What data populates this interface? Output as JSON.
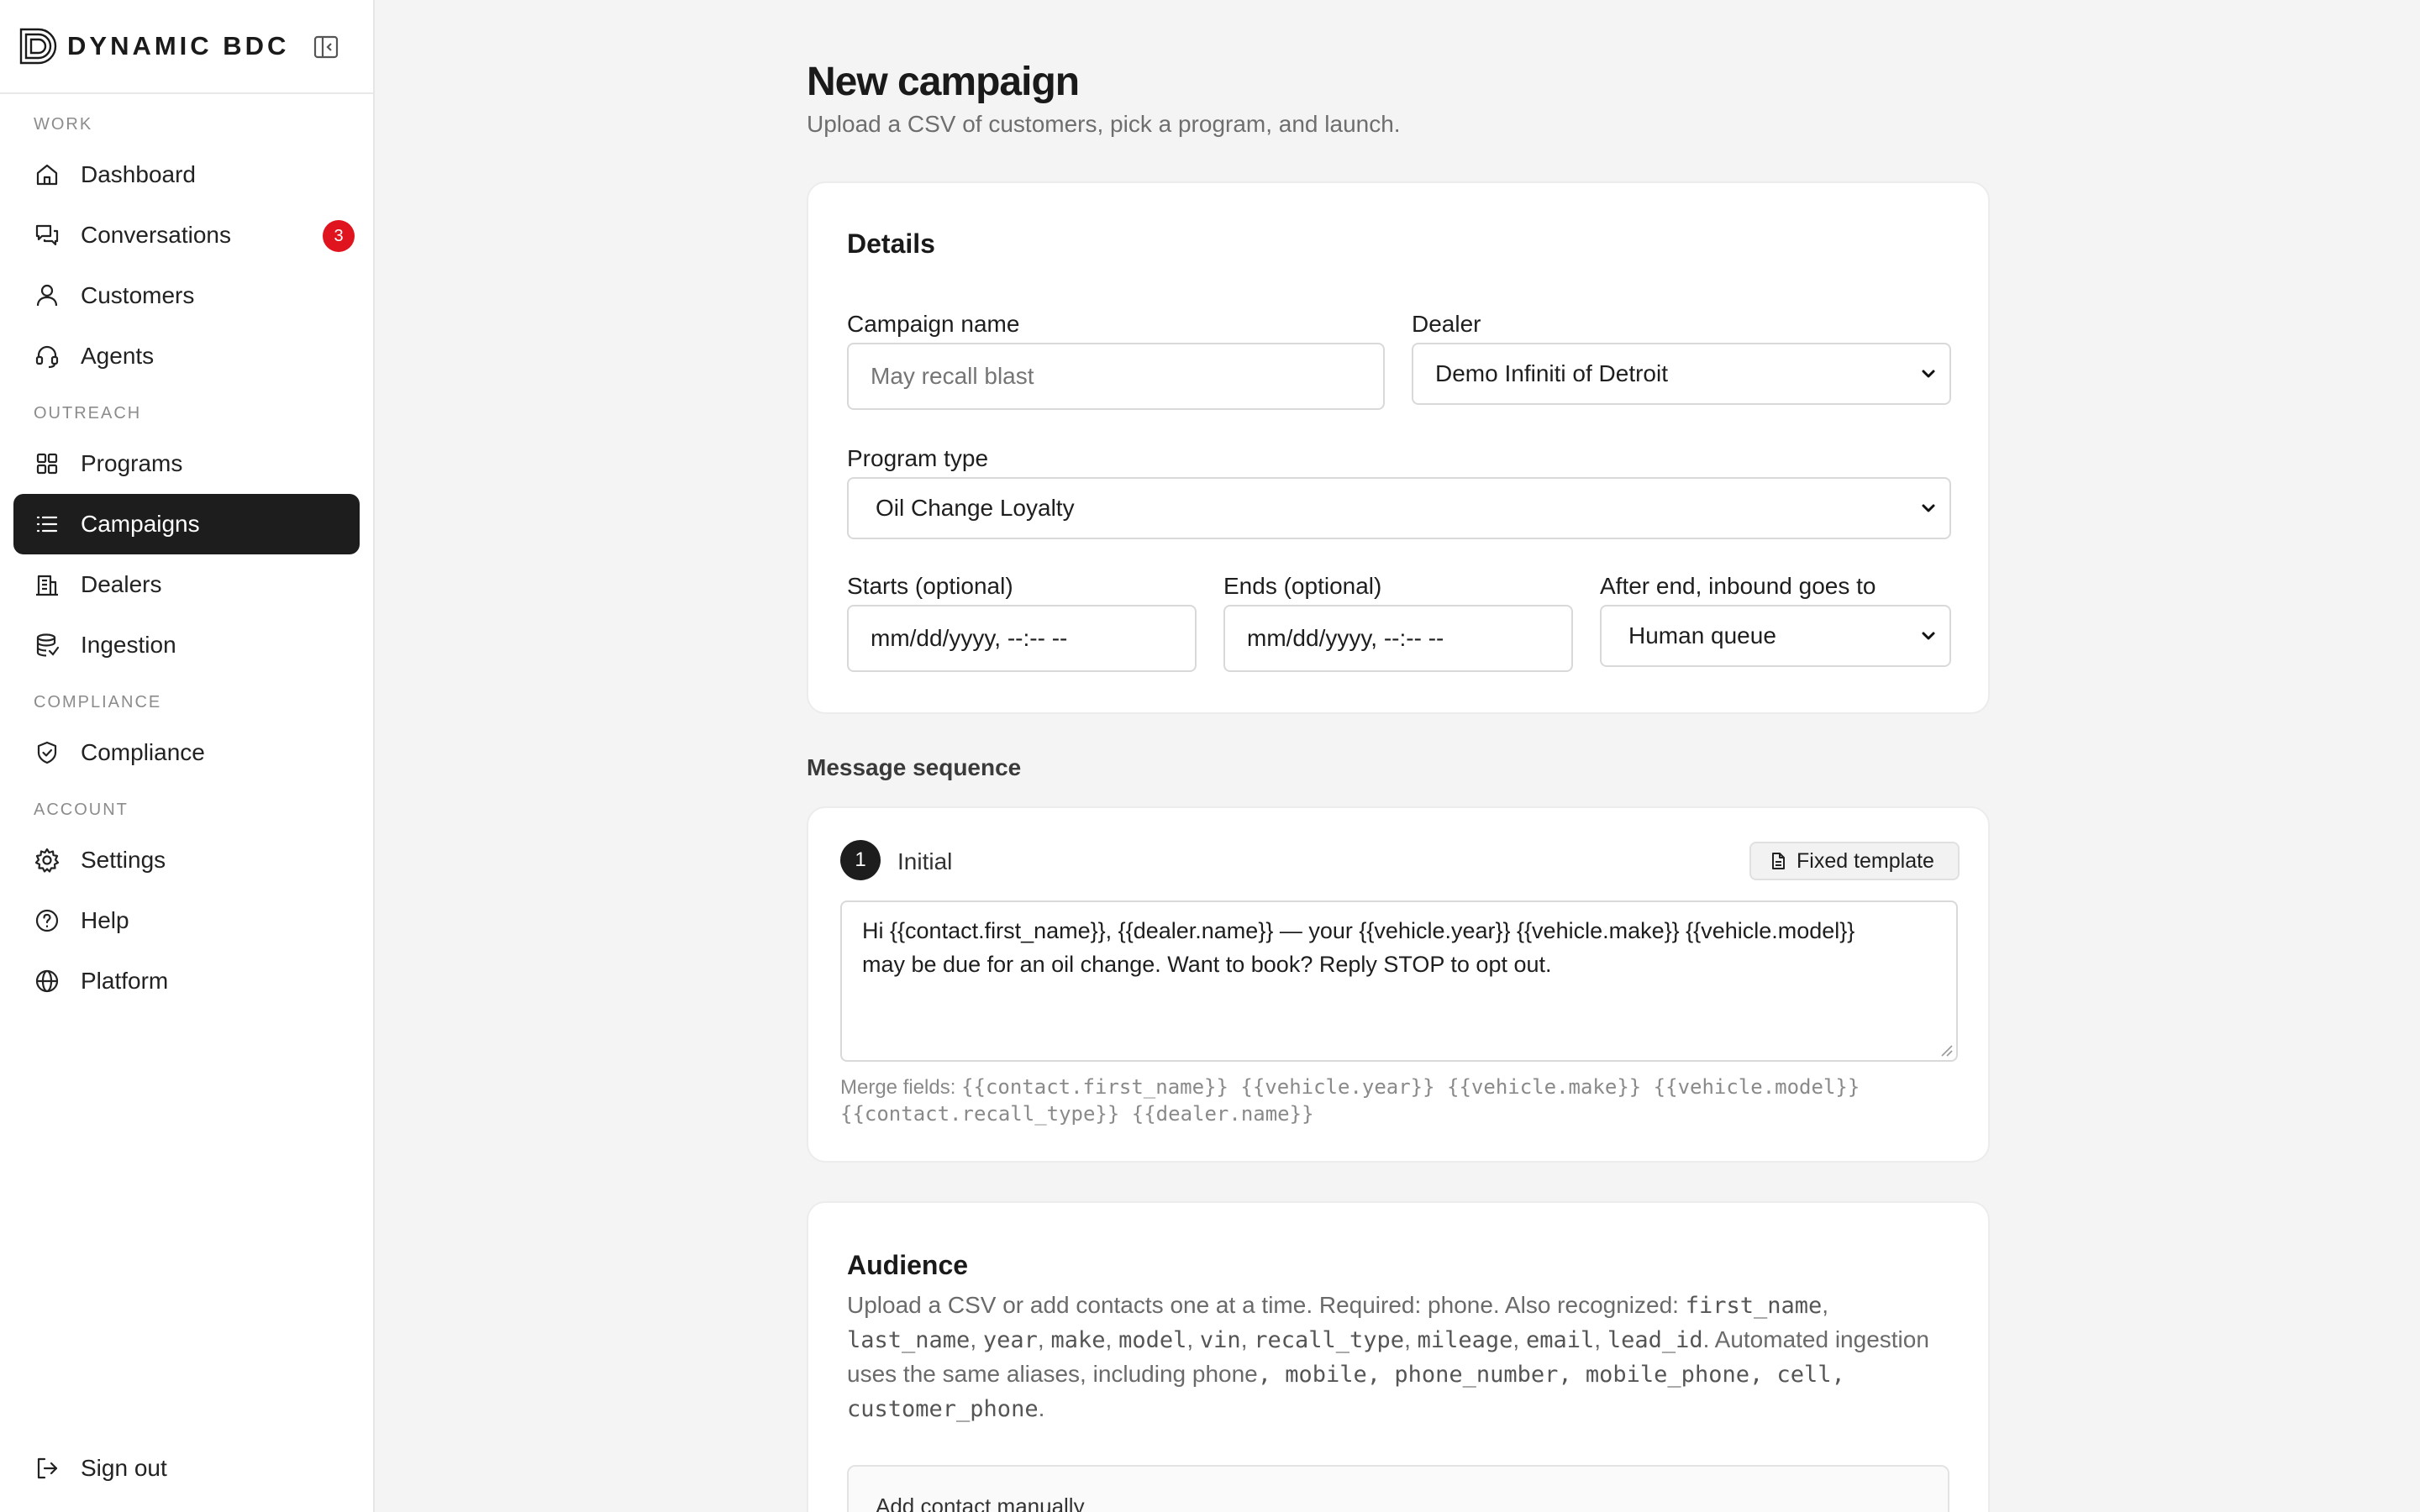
{
  "brand": {
    "name": "DYNAMIC BDC"
  },
  "sidebar": {
    "sections": {
      "work": "WORK",
      "outreach": "OUTREACH",
      "compliance": "COMPLIANCE",
      "account": "ACCOUNT"
    },
    "items": {
      "dashboard": "Dashboard",
      "conversations": "Conversations",
      "conversations_badge": "3",
      "customers": "Customers",
      "agents": "Agents",
      "programs": "Programs",
      "campaigns": "Campaigns",
      "dealers": "Dealers",
      "ingestion": "Ingestion",
      "compliance": "Compliance",
      "settings": "Settings",
      "help": "Help",
      "platform": "Platform",
      "sign_out": "Sign out"
    },
    "active_item": "campaigns"
  },
  "page": {
    "title": "New campaign",
    "subtitle": "Upload a CSV of customers, pick a program, and launch."
  },
  "details": {
    "title": "Details",
    "campaign_name_label": "Campaign name",
    "campaign_name_value": "",
    "campaign_name_placeholder": "May recall blast",
    "dealer_label": "Dealer",
    "dealer_value": "Demo Infiniti of Detroit",
    "program_type_label": "Program type",
    "program_type_value": "Oil Change Loyalty",
    "starts_label": "Starts (optional)",
    "starts_value": "mm/dd/yyyy, --:-- --",
    "ends_label": "Ends (optional)",
    "ends_value": "mm/dd/yyyy, --:-- --",
    "after_end_label": "After end, inbound goes to",
    "after_end_value": "Human queue"
  },
  "sequence": {
    "heading": "Message sequence",
    "step_number": "1",
    "step_label": "Initial",
    "template_button": "Fixed template",
    "message_line1": "Hi {{contact.first_name}}, {{dealer.name}} — your {{vehicle.year}} {{vehicle.make}} {{vehicle.model}}",
    "message_line2": "may be due for an oil change. Want to book? Reply STOP to opt out.",
    "merge_prefix": "Merge fields:",
    "merge_line1": "{{contact.first_name}} {{vehicle.year}} {{vehicle.make}} {{vehicle.model}}",
    "merge_line2": "{{contact.recall_type}} {{dealer.name}}"
  },
  "audience": {
    "title": "Audience",
    "desc_1": "Upload a CSV or add contacts one at a time. Required: phone. Also recognized: ",
    "code_1": "first_name",
    "sep_1": ", ",
    "code_2": "last_name",
    "sep_2": ", ",
    "code_3": "year",
    "sep_3": ", ",
    "code_4": "make",
    "sep_4": ", ",
    "code_5": "model",
    "sep_5": ", ",
    "code_6": "vin",
    "sep_6": ", ",
    "code_7": "recall_type",
    "sep_7": ", ",
    "code_8": "mileage",
    "sep_8": ", ",
    "code_9": "email",
    "sep_9": ", ",
    "code_10": "lead_id",
    "desc_2": ". Automated ingestion uses the same aliases, including phone",
    "code_11": ", mobile, phone_number, mobile_phone, cell, customer_phone",
    "desc_3": ".",
    "manual_label": "Add contact manually"
  }
}
